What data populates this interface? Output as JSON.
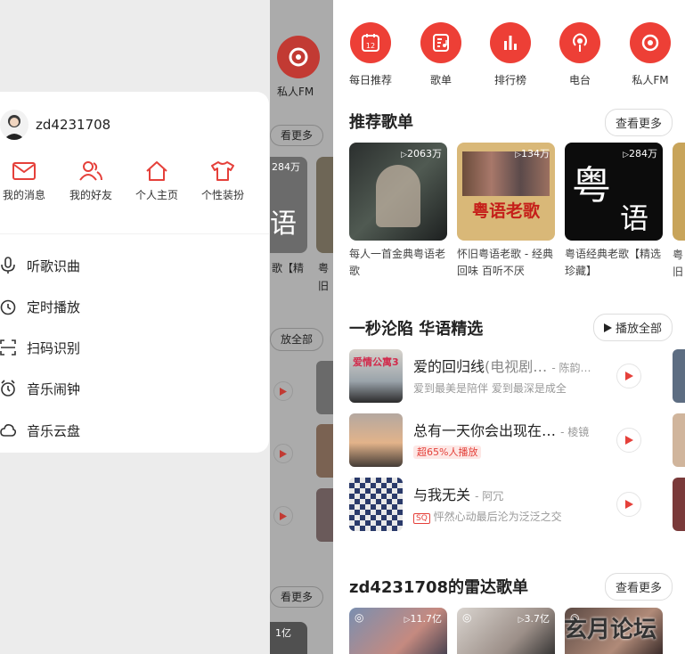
{
  "drawer": {
    "username": "zd4231708",
    "quick_actions": [
      {
        "label": "我的消息",
        "icon": "mail-icon"
      },
      {
        "label": "我的好友",
        "icon": "friends-icon"
      },
      {
        "label": "个人主页",
        "icon": "home-icon"
      },
      {
        "label": "个性装扮",
        "icon": "tshirt-icon"
      }
    ],
    "menu": [
      {
        "label": "听歌识曲",
        "icon": "microphone-icon"
      },
      {
        "label": "定时播放",
        "icon": "timer-icon"
      },
      {
        "label": "扫码识别",
        "icon": "scan-icon"
      },
      {
        "label": "音乐闹钟",
        "icon": "alarm-icon"
      },
      {
        "label": "音乐云盘",
        "icon": "cloud-icon"
      }
    ]
  },
  "strip": {
    "fm_label": "私人FM",
    "more_1": "看更多",
    "count": "284万",
    "play_all": "放全部",
    "more_2": "看更多",
    "count2": "1亿",
    "partial_1": "歌【精",
    "partial_2": "粤",
    "partial_3": "旧"
  },
  "nav": [
    {
      "label": "每日推荐",
      "icon": "calendar-icon",
      "badge": "12"
    },
    {
      "label": "歌单",
      "icon": "playlist-icon"
    },
    {
      "label": "排行榜",
      "icon": "chart-bars-icon"
    },
    {
      "label": "电台",
      "icon": "podcast-icon"
    },
    {
      "label": "私人FM",
      "icon": "fm-icon"
    }
  ],
  "recommended": {
    "title": "推荐歌单",
    "more": "查看更多",
    "playlists": [
      {
        "count": "2063万",
        "title": "每人一首金典粤语老歌"
      },
      {
        "count": "134万",
        "title": "怀旧粤语老歌 - 经典回味 百听不厌",
        "cover_text": "粤语老歌"
      },
      {
        "count": "284万",
        "title": "粤语经典老歌【精选珍藏】",
        "cover_text_1": "粤",
        "cover_text_2": "语"
      }
    ],
    "partial_next": "粤",
    "partial_next_2": "旧"
  },
  "section2": {
    "title": "一秒沦陷 华语精选",
    "play_all": "播放全部",
    "songs": [
      {
        "title": "爱的回归线",
        "suffix": "(电视剧…",
        "artist": "- 陈韵…",
        "sub": "爱到最美是陪伴 爱到最深是成全",
        "cover_text": "爱情公寓3"
      },
      {
        "title": "总有一天你会出现在…",
        "suffix": "",
        "artist": "- 棱镜",
        "tag": "超65%人播放"
      },
      {
        "title": "与我无关",
        "suffix": "",
        "artist": "- 阿冗",
        "sq": "SQ",
        "sub": "怦然心动最后沦为泛泛之交"
      }
    ]
  },
  "radar": {
    "title": "zd4231708的雷达歌单",
    "more": "查看更多",
    "counts": [
      "11.7亿",
      "3.7亿"
    ],
    "watermark": "玄月论坛"
  },
  "colors": {
    "accent": "#ed3f36"
  }
}
